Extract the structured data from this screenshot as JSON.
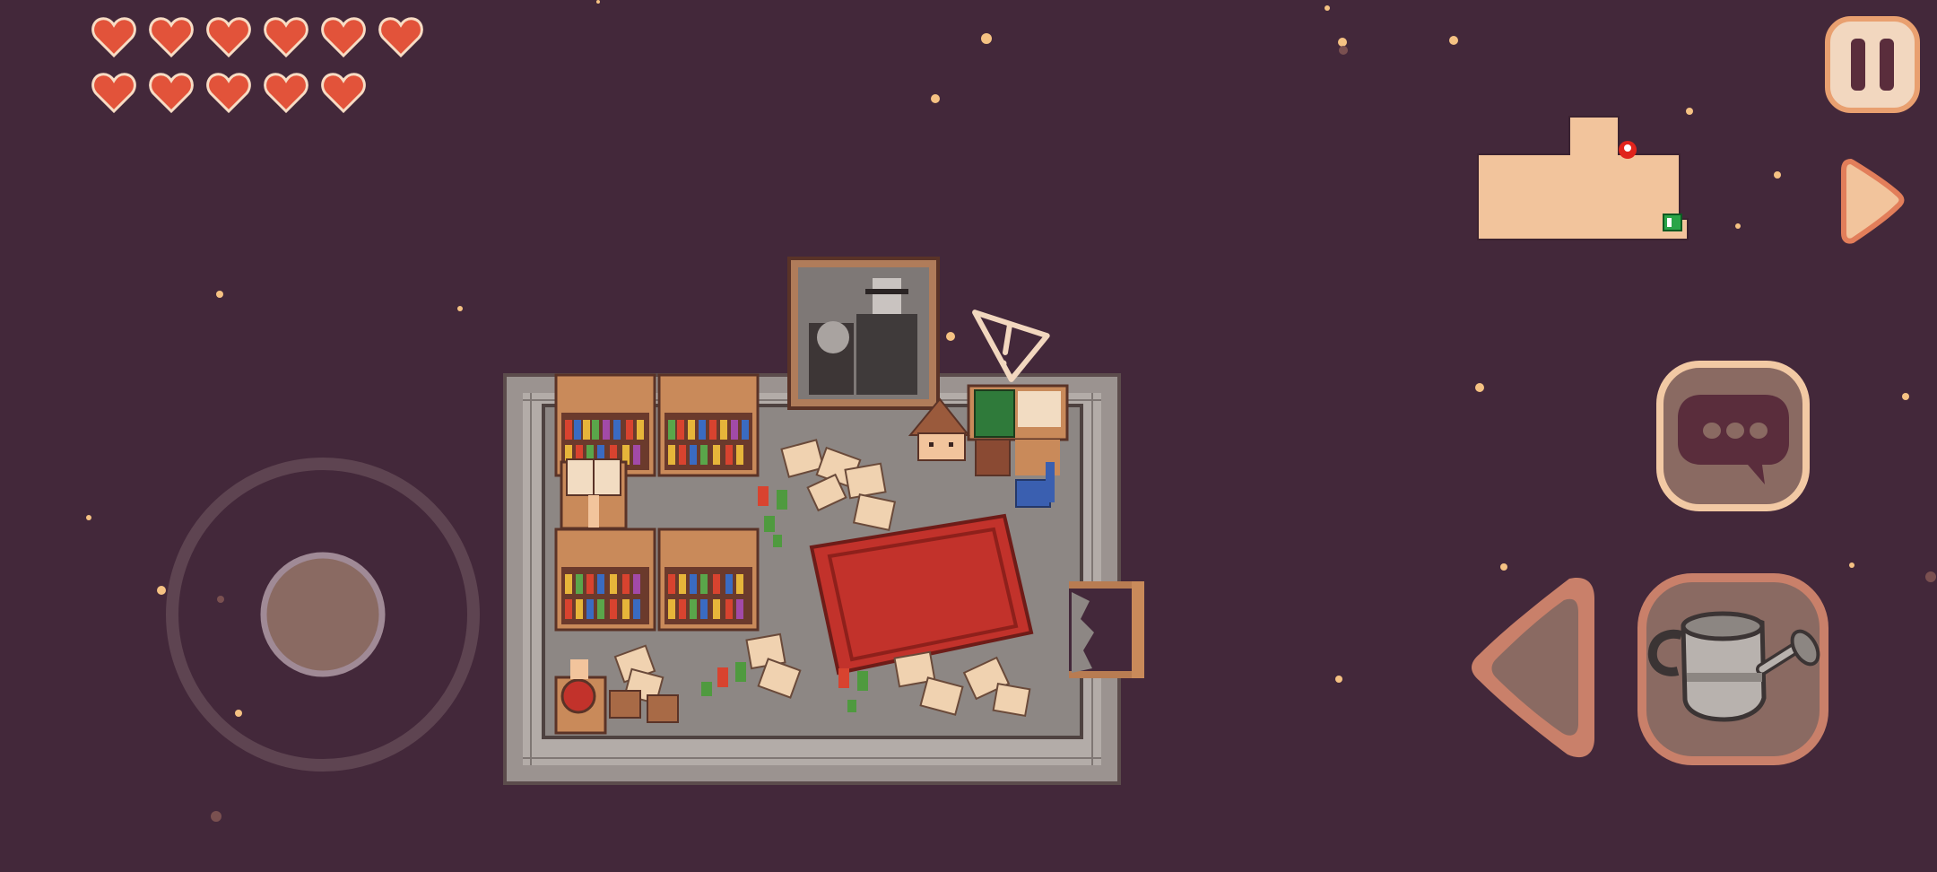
{
  "colors": {
    "background": "#43283a",
    "heart": "#e2533a",
    "heart_outline": "#f7dcc4",
    "button_fill": "#8a6a62",
    "button_rim": "#f2c9a4",
    "button_icon": "#5a2d3c",
    "minimap_fill": "#f2c49c",
    "room_floor": "#8f8a86",
    "room_wall": "#b6aeaa",
    "rug": "#c2322b",
    "stars": "#f5c283"
  },
  "hud": {
    "hearts": [
      {
        "state": "full"
      },
      {
        "state": "full"
      },
      {
        "state": "full"
      },
      {
        "state": "full"
      },
      {
        "state": "full"
      },
      {
        "state": "full"
      },
      {
        "state": "full"
      },
      {
        "state": "full"
      },
      {
        "state": "full"
      },
      {
        "state": "full"
      },
      {
        "state": "full"
      }
    ],
    "buttons": {
      "pause": {
        "icon": "pause-icon"
      },
      "next": {
        "icon": "play-right-icon"
      },
      "prev": {
        "icon": "play-left-icon"
      },
      "talk": {
        "icon": "speech-bubble-icon"
      },
      "item": {
        "icon": "watering-can-icon"
      }
    },
    "minimap": {
      "player_marker": "map-pin-icon",
      "exit_marker": "exit-sign-icon"
    },
    "alert": {
      "icon": "warning-triangle-icon",
      "symbol": "!"
    }
  },
  "joystick": {
    "knob_offset": [
      0,
      0
    ]
  }
}
